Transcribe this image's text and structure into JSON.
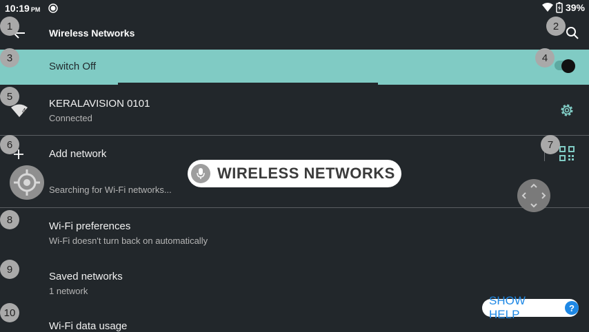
{
  "status_bar": {
    "time": "10:19",
    "ampm": "PM",
    "battery": "39%"
  },
  "toolbar": {
    "title": "Wireless Networks"
  },
  "master_switch": {
    "label": "Switch Off",
    "scanning_progress": 0.44
  },
  "networks": [
    {
      "name": "KERALAVISION 0101",
      "status": "Connected",
      "signal_level": "4"
    }
  ],
  "add_network": {
    "label": "Add network"
  },
  "scanning": {
    "text": "Searching for Wi-Fi networks..."
  },
  "settings": [
    {
      "title": "Wi-Fi preferences",
      "summary": "Wi-Fi doesn't turn back on automatically"
    },
    {
      "title": "Saved networks",
      "summary": "1 network"
    },
    {
      "title": "Wi-Fi data usage",
      "summary": ""
    }
  ],
  "overlay": {
    "voice_label": "WIRELESS NETWORKS",
    "help_label": "SHOW HELP",
    "help_icon_text": "?"
  },
  "badges": [
    "1",
    "2",
    "3",
    "4",
    "5",
    "6",
    "7",
    "8",
    "9",
    "10"
  ],
  "colors": {
    "background": "#22272b",
    "accent": "#80cbc4",
    "help_blue": "#1e88e5"
  },
  "icons": [
    "back-arrow-icon",
    "search-icon",
    "wifi-signal-icon",
    "gear-icon",
    "plus-icon",
    "qr-code-icon",
    "mic-icon",
    "crosshair-icon",
    "move-arrows-icon",
    "screen-record-icon",
    "battery-icon"
  ]
}
